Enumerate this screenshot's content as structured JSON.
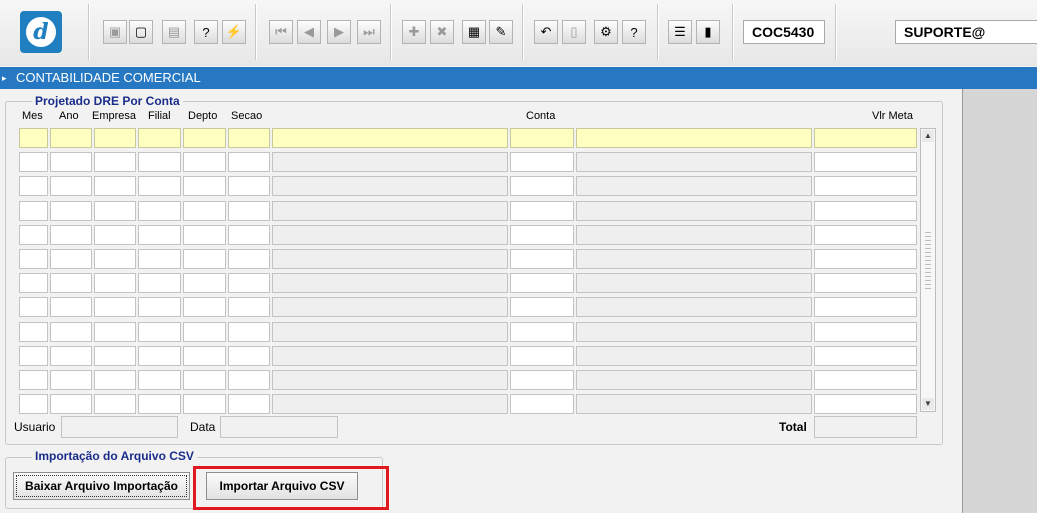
{
  "toolbar": {
    "logo": "d",
    "form_code": "COC5430",
    "user": "SUPORTE@",
    "icons": [
      {
        "name": "save-icon",
        "glyph": "▣",
        "disabled": true
      },
      {
        "name": "window-icon",
        "glyph": "▢",
        "disabled": false
      },
      {
        "name": "print-icon",
        "glyph": "▤",
        "disabled": true
      },
      {
        "name": "query-icon",
        "glyph": "?",
        "disabled": false
      },
      {
        "name": "execute-query-icon",
        "glyph": "⚡",
        "disabled": false
      },
      {
        "name": "first-record-icon",
        "glyph": "⏮",
        "disabled": true
      },
      {
        "name": "previous-record-icon",
        "glyph": "◀",
        "disabled": true
      },
      {
        "name": "next-record-icon",
        "glyph": "▶",
        "disabled": true
      },
      {
        "name": "last-record-icon",
        "glyph": "⏭",
        "disabled": true
      },
      {
        "name": "insert-record-icon",
        "glyph": "✚",
        "disabled": true
      },
      {
        "name": "delete-record-icon",
        "glyph": "✖",
        "disabled": true
      },
      {
        "name": "list-values-icon",
        "glyph": "▦",
        "disabled": false
      },
      {
        "name": "edit-icon",
        "glyph": "✎",
        "disabled": false
      },
      {
        "name": "undo-icon",
        "glyph": "↶",
        "disabled": false
      },
      {
        "name": "clipboard-icon",
        "glyph": "▯",
        "disabled": true
      },
      {
        "name": "settings-icon",
        "glyph": "⚙",
        "disabled": false
      },
      {
        "name": "help-icon",
        "glyph": "?",
        "disabled": false
      },
      {
        "name": "menu-icon",
        "glyph": "☰",
        "disabled": false
      },
      {
        "name": "exit-icon",
        "glyph": "▮",
        "disabled": false
      }
    ]
  },
  "titlebar": {
    "text": "CONTABILIDADE COMERCIAL"
  },
  "block": {
    "title": "Projetado DRE Por Conta",
    "columns": {
      "mes": "Mes",
      "ano": "Ano",
      "empresa": "Empresa",
      "filial": "Filial",
      "depto": "Depto",
      "secao": "Secao",
      "conta": "Conta",
      "vlr_meta": "Vlr Meta"
    },
    "row_count": 12
  },
  "footer": {
    "usuario_label": "Usuario",
    "data_label": "Data",
    "total_label": "Total"
  },
  "import": {
    "title": "Importação do Arquivo CSV",
    "download_button": "Baixar Arquivo Importação",
    "import_button": "Importar Arquivo CSV"
  },
  "colors": {
    "title_bar": "#2778c3",
    "current_row": "#ffffc0",
    "highlight": "#e0181f",
    "frame_title": "#1a2d8a"
  }
}
